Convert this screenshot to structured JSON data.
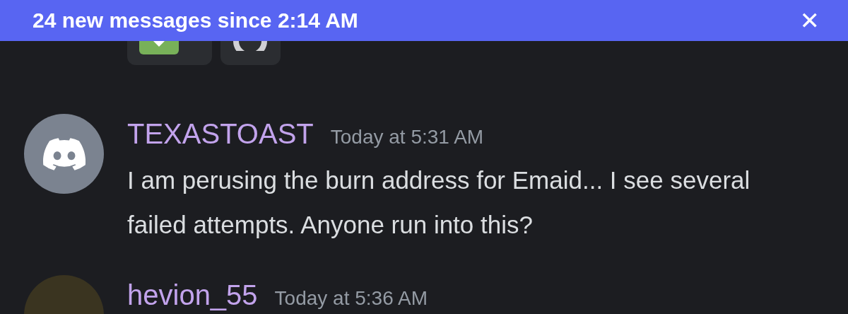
{
  "banner": {
    "text": "24 new messages since 2:14 AM",
    "close": "✕"
  },
  "reactions": [
    {
      "kind": "check"
    },
    {
      "kind": "ring"
    }
  ],
  "messages": [
    {
      "avatar": {
        "kind": "logo"
      },
      "username": "TEXASTOAST",
      "timestamp": "Today at 5:31 AM",
      "text": "I am perusing the burn address for Emaid... I see several failed attempts. Anyone run into this?"
    },
    {
      "avatar": {
        "kind": "photo"
      },
      "username": "hevion_55",
      "timestamp": "Today at 5:36 AM"
    }
  ]
}
